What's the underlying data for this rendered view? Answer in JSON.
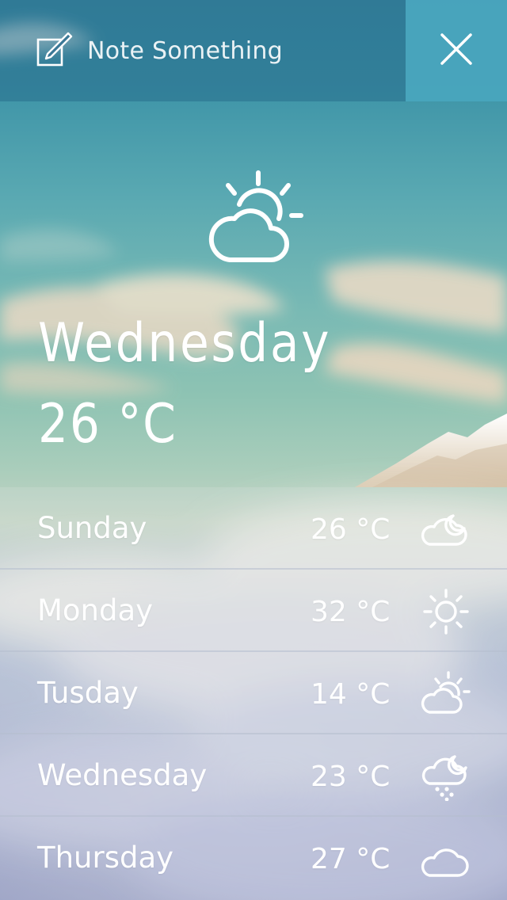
{
  "header": {
    "note_label": "Note Something",
    "note_icon": "edit-note-icon",
    "close_icon": "close-icon"
  },
  "current": {
    "day": "Wednesday",
    "temperature": "26 °C",
    "icon": "partly-cloudy-icon"
  },
  "forecast": [
    {
      "day": "Sunday",
      "temperature": "26 °C",
      "icon": "cloudy-night-icon"
    },
    {
      "day": "Monday",
      "temperature": "32 °C",
      "icon": "sunny-icon"
    },
    {
      "day": "Tusday",
      "temperature": "14 °C",
      "icon": "partly-cloudy-icon"
    },
    {
      "day": "Wednesday",
      "temperature": "23 °C",
      "icon": "rain-night-icon"
    },
    {
      "day": "Thursday",
      "temperature": "27 °C",
      "icon": "cloud-icon"
    }
  ],
  "colors": {
    "sky_top": "#3c8da4",
    "close_button": "#50b2c8",
    "text": "#ffffff"
  }
}
